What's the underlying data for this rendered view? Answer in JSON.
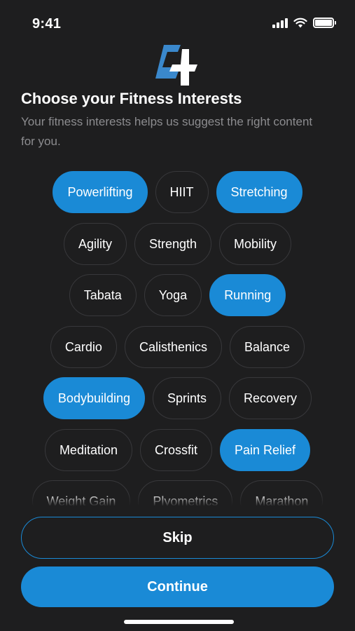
{
  "status_bar": {
    "time": "9:41"
  },
  "header": {
    "title": "Choose your Fitness Interests",
    "subtitle": "Your fitness interests helps us suggest the right content for you."
  },
  "interests": [
    {
      "label": "Powerlifting",
      "selected": true
    },
    {
      "label": "HIIT",
      "selected": false
    },
    {
      "label": "Stretching",
      "selected": true
    },
    {
      "label": "Agility",
      "selected": false
    },
    {
      "label": "Strength",
      "selected": false
    },
    {
      "label": "Mobility",
      "selected": false
    },
    {
      "label": "Tabata",
      "selected": false
    },
    {
      "label": "Yoga",
      "selected": false
    },
    {
      "label": "Running",
      "selected": true
    },
    {
      "label": "Cardio",
      "selected": false
    },
    {
      "label": "Calisthenics",
      "selected": false
    },
    {
      "label": "Balance",
      "selected": false
    },
    {
      "label": "Bodybuilding",
      "selected": true
    },
    {
      "label": "Sprints",
      "selected": false
    },
    {
      "label": "Recovery",
      "selected": false
    },
    {
      "label": "Meditation",
      "selected": false
    },
    {
      "label": "Crossfit",
      "selected": false
    },
    {
      "label": "Pain Relief",
      "selected": true
    },
    {
      "label": "Weight Gain",
      "selected": false
    },
    {
      "label": "Plyometrics",
      "selected": false
    },
    {
      "label": "Marathon",
      "selected": false
    }
  ],
  "buttons": {
    "skip": "Skip",
    "continue": "Continue"
  },
  "colors": {
    "accent": "#1a8ad6",
    "background": "#1e1e1f",
    "chip_border": "#38383b",
    "subtitle": "#8c8c8f"
  },
  "icons": {
    "logo": "app-logo-icon",
    "signal": "cellular-signal-icon",
    "wifi": "wifi-icon",
    "battery": "battery-icon"
  }
}
